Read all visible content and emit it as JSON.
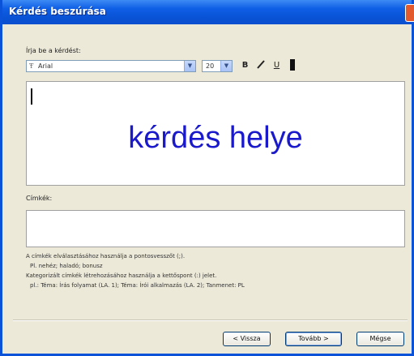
{
  "window": {
    "title": "Kérdés beszúrása"
  },
  "question": {
    "label": "Írja be a kérdést:",
    "font": "Arial",
    "size": "20",
    "bold_label": "B",
    "italic_label": "I",
    "underline_label": "U",
    "placeholder_text": "kérdés helye"
  },
  "tags": {
    "label": "Címkék:",
    "value": ""
  },
  "help": {
    "line1": "A címkék elválasztásához használja a pontosvesszőt (;).",
    "line2": "Pl. nehéz; haladó; bonusz",
    "line3": "Kategorizált címkék létrehozásához használja a kettőspont (:) jelet.",
    "line4": "pl.: Téma: Írás folyamat (LA. 1); Téma: Írói alkalmazás (LA. 2); Tanmenet: PL"
  },
  "buttons": {
    "back": "< Vissza",
    "next": "Tovább >",
    "cancel": "Mégse"
  },
  "colors": {
    "title_bar": "#0a53d8",
    "editor_text": "#1a1acc"
  }
}
